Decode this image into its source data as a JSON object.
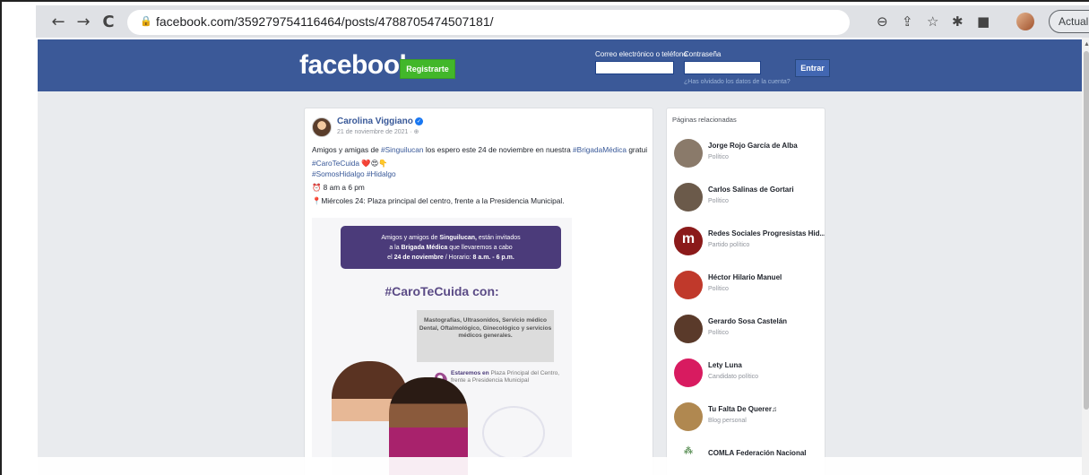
{
  "browser": {
    "url": "facebook.com/359279754116464/posts/4788705474507181/",
    "back_icon": "arrow-left-icon",
    "forward_icon": "arrow-right-icon",
    "reload_icon": "reload-icon",
    "update_button": "Actualizar"
  },
  "header": {
    "logo": "facebook",
    "register_button": "Registrarte",
    "email_label": "Correo electrónico o teléfono",
    "password_label": "Contraseña",
    "login_button": "Entrar",
    "forgot_link": "¿Has olvidado los datos de la cuenta?"
  },
  "post": {
    "author": "Carolina Viggiano",
    "date": "21 de noviembre de 2021 · ",
    "text_line1_a": "Amigos y amigas de ",
    "text_line1_tag1": "#Singuilucan",
    "text_line1_b": " los espero este 24 de noviembre en nuestra ",
    "text_line1_tag2": "#BrigadaMédica",
    "text_line1_c": " gratuita.",
    "tag_line2": "#CaroTeCuida",
    "emoji_line2": "❤️😍👇",
    "tag_line3a": "#SomosHidalgo",
    "tag_line3b": "#Hidalgo",
    "time_line": "8 am a 6 pm",
    "place_line": "Miércoles 24: Plaza principal del centro, frente a la Presidencia Municipal.",
    "image": {
      "banner_l1_a": "Amigos y amigos de ",
      "banner_l1_b": "Singuilucan,",
      "banner_l1_c": " están invitados",
      "banner_l2_a": "a la ",
      "banner_l2_b": "Brigada Médica",
      "banner_l2_c": " que llevaremos a cabo",
      "banner_l3_a": "el ",
      "banner_l3_b": "24 de noviembre",
      "banner_l3_c": " / Horario: ",
      "banner_l3_d": "8 a.m. - 6 p.m.",
      "title": "#CaroTeCuida con:",
      "services": "Mastografías, Ultrasonidos, Servicio médico Dental, Oftalmológico, Ginecológico y servicios médicos generales.",
      "location_bold": "Estaremos en",
      "location_rest": " Plaza Principal del Centro, frente a Presidencia Municipal"
    }
  },
  "related": {
    "header": "Páginas relacionadas",
    "items": [
      {
        "name": "Jorge Rojo García de Alba",
        "category": "Político",
        "color": "#8a7a6a"
      },
      {
        "name": "Carlos Salinas de Gortari",
        "category": "Político",
        "color": "#6b5a4a"
      },
      {
        "name": "Redes Sociales Progresistas Hid...",
        "category": "Partido político",
        "color": "#8b1a1a",
        "logo": "m"
      },
      {
        "name": "Héctor Hilario Manuel",
        "category": "Político",
        "color": "#c0392b"
      },
      {
        "name": "Gerardo Sosa Castelán",
        "category": "Político",
        "color": "#5a3a2a"
      },
      {
        "name": "Lety Luna",
        "category": "Candidato político",
        "color": "#d81b60"
      },
      {
        "name": "Tu Falta De Querer♫",
        "category": "Blog personal",
        "color": "#b08850"
      },
      {
        "name": "COMLA Federación Nacional",
        "category": "",
        "color": "#6a9a66",
        "logo": "cq"
      }
    ]
  }
}
